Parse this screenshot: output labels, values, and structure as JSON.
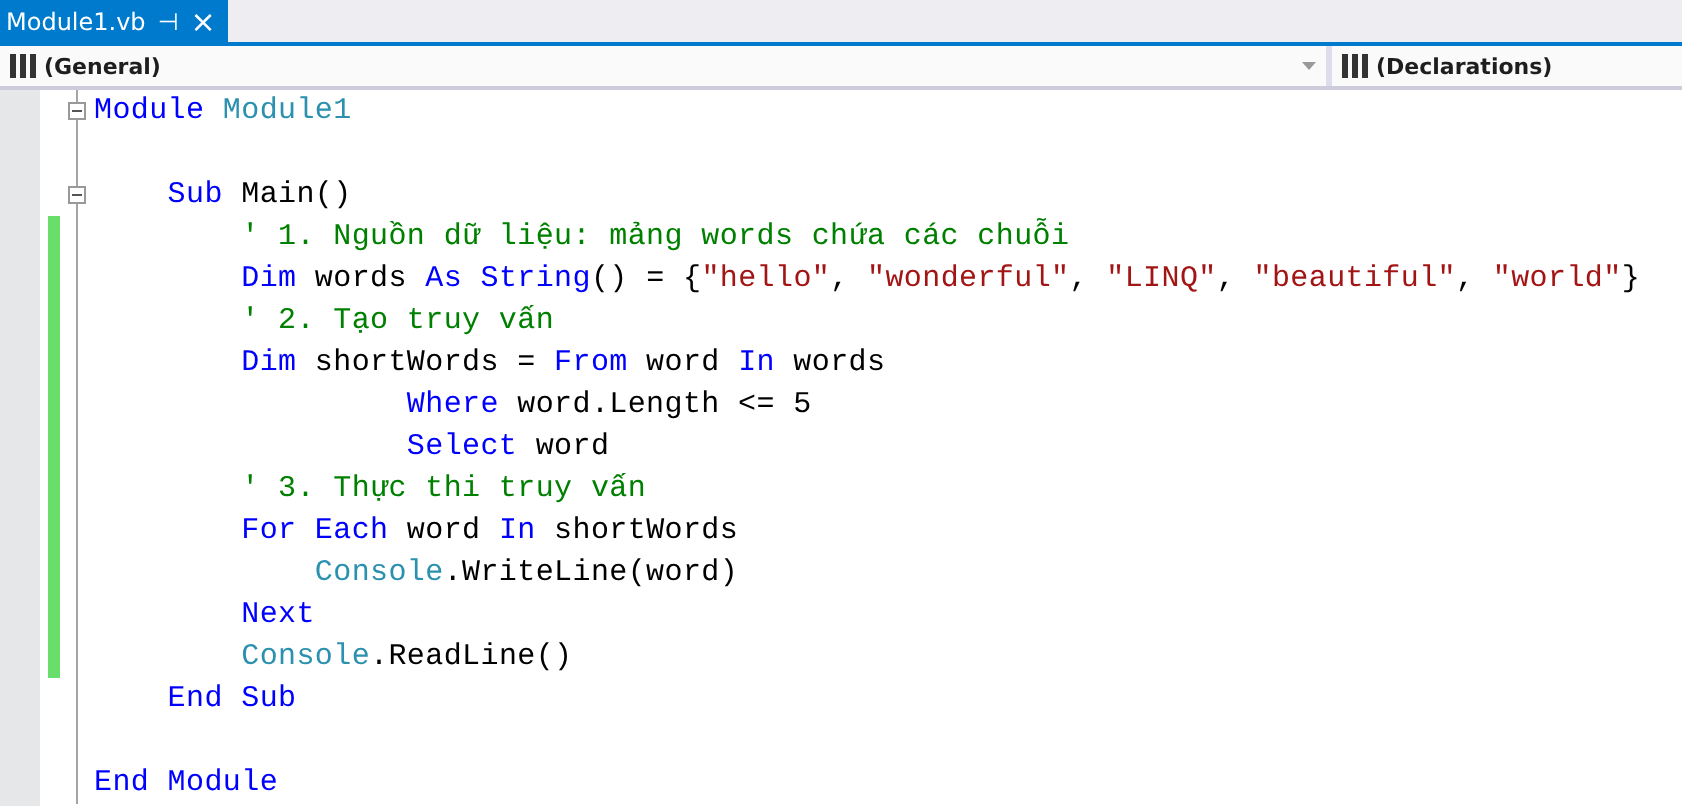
{
  "tab": {
    "title": "Module1.vb",
    "pin": "⊣",
    "close": "×"
  },
  "navigation_bar": {
    "left": "(General)",
    "right": "(Declarations)"
  },
  "lines": [
    {
      "expanded": true,
      "changed": false,
      "tokens": [
        {
          "kind": "keyword",
          "text": "Module"
        },
        {
          "kind": "type",
          "text": " Module1"
        }
      ]
    },
    {
      "changed": false
    },
    {
      "expanded": true,
      "changed": false,
      "tokens": [
        {
          "kind": "keyword",
          "text": "    Sub"
        },
        {
          "kind": "plain",
          "text": " Main()"
        }
      ]
    },
    {
      "changed": true,
      "tokens": [
        {
          "kind": "comment",
          "text": "        ' 1. Nguồn dữ liệu: mảng words chứa các chuỗi"
        }
      ]
    },
    {
      "changed": true,
      "tokens": [
        {
          "kind": "keyword",
          "text": "        Dim"
        },
        {
          "kind": "plain",
          "text": " words "
        },
        {
          "kind": "keyword",
          "text": "As String"
        },
        {
          "kind": "plain",
          "text": "() = {"
        },
        {
          "kind": "string",
          "text": "\"hello\""
        },
        {
          "kind": "plain",
          "text": ", "
        },
        {
          "kind": "string",
          "text": "\"wonderful\""
        },
        {
          "kind": "plain",
          "text": ", "
        },
        {
          "kind": "string",
          "text": "\"LINQ\""
        },
        {
          "kind": "plain",
          "text": ", "
        },
        {
          "kind": "string",
          "text": "\"beautiful\""
        },
        {
          "kind": "plain",
          "text": ", "
        },
        {
          "kind": "string",
          "text": "\"world\""
        },
        {
          "kind": "plain",
          "text": "}"
        }
      ]
    },
    {
      "changed": true,
      "tokens": [
        {
          "kind": "comment",
          "text": "        ' 2. Tạo truy vấn"
        }
      ]
    },
    {
      "changed": true,
      "tokens": [
        {
          "kind": "keyword",
          "text": "        Dim"
        },
        {
          "kind": "plain",
          "text": " shortWords = "
        },
        {
          "kind": "keyword",
          "text": "From"
        },
        {
          "kind": "plain",
          "text": " word "
        },
        {
          "kind": "keyword",
          "text": "In"
        },
        {
          "kind": "plain",
          "text": " words"
        }
      ]
    },
    {
      "changed": true,
      "tokens": [
        {
          "kind": "keyword",
          "text": "                 Where"
        },
        {
          "kind": "plain",
          "text": " word.Length <= 5"
        }
      ]
    },
    {
      "changed": true,
      "tokens": [
        {
          "kind": "keyword",
          "text": "                 Select"
        },
        {
          "kind": "plain",
          "text": " word"
        }
      ]
    },
    {
      "changed": true,
      "tokens": [
        {
          "kind": "comment",
          "text": "        ' 3. Thực thi truy vấn"
        }
      ]
    },
    {
      "changed": true,
      "tokens": [
        {
          "kind": "keyword",
          "text": "        For Each"
        },
        {
          "kind": "plain",
          "text": " word "
        },
        {
          "kind": "keyword",
          "text": "In"
        },
        {
          "kind": "plain",
          "text": " shortWords"
        }
      ]
    },
    {
      "changed": true,
      "tokens": [
        {
          "kind": "type",
          "text": "            Console"
        },
        {
          "kind": "plain",
          "text": ".WriteLine(word)"
        }
      ]
    },
    {
      "changed": true,
      "tokens": [
        {
          "kind": "keyword",
          "text": "        Next"
        }
      ]
    },
    {
      "changed": true,
      "tokens": [
        {
          "kind": "type",
          "text": "        Console"
        },
        {
          "kind": "plain",
          "text": ".ReadLine()"
        }
      ]
    },
    {
      "changed": false,
      "tokens": [
        {
          "kind": "keyword",
          "text": "    End Sub"
        }
      ]
    },
    {
      "changed": false
    },
    {
      "changed": false,
      "tokens": [
        {
          "kind": "keyword",
          "text": "End Module"
        }
      ]
    }
  ]
}
